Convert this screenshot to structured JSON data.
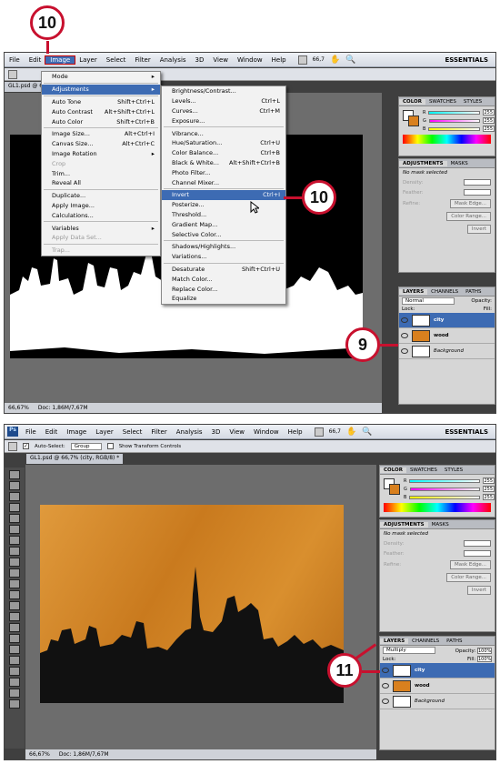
{
  "shot1": {
    "menubar": [
      "File",
      "Edit",
      "Image",
      "Layer",
      "Select",
      "Filter",
      "Analysis",
      "3D",
      "View",
      "Window",
      "Help"
    ],
    "zoom": "66,7",
    "workspace": "ESSENTIALS",
    "doc_tab": "GL1.psd @ 66,7",
    "status_zoom": "66,67%",
    "status_doc": "Doc: 1,86M/7,67M",
    "image_menu": [
      {
        "label": "Mode",
        "shortcut": "",
        "sub": true
      },
      {
        "sep": true
      },
      {
        "label": "Adjustments",
        "shortcut": "",
        "sub": true,
        "hl": true
      },
      {
        "sep": true
      },
      {
        "label": "Auto Tone",
        "shortcut": "Shift+Ctrl+L"
      },
      {
        "label": "Auto Contrast",
        "shortcut": "Alt+Shift+Ctrl+L"
      },
      {
        "label": "Auto Color",
        "shortcut": "Shift+Ctrl+B"
      },
      {
        "sep": true
      },
      {
        "label": "Image Size...",
        "shortcut": "Alt+Ctrl+I"
      },
      {
        "label": "Canvas Size...",
        "shortcut": "Alt+Ctrl+C"
      },
      {
        "label": "Image Rotation",
        "shortcut": "",
        "sub": true
      },
      {
        "label": "Crop",
        "shortcut": "",
        "dis": true
      },
      {
        "label": "Trim...",
        "shortcut": ""
      },
      {
        "label": "Reveal All",
        "shortcut": ""
      },
      {
        "sep": true
      },
      {
        "label": "Duplicate...",
        "shortcut": ""
      },
      {
        "label": "Apply Image...",
        "shortcut": ""
      },
      {
        "label": "Calculations...",
        "shortcut": ""
      },
      {
        "sep": true
      },
      {
        "label": "Variables",
        "shortcut": "",
        "sub": true
      },
      {
        "label": "Apply Data Set...",
        "shortcut": "",
        "dis": true
      },
      {
        "sep": true
      },
      {
        "label": "Trap...",
        "shortcut": "",
        "dis": true
      }
    ],
    "adj_menu": [
      {
        "label": "Brightness/Contrast...",
        "shortcut": ""
      },
      {
        "label": "Levels...",
        "shortcut": "Ctrl+L"
      },
      {
        "label": "Curves...",
        "shortcut": "Ctrl+M"
      },
      {
        "label": "Exposure...",
        "shortcut": ""
      },
      {
        "sep": true
      },
      {
        "label": "Vibrance...",
        "shortcut": ""
      },
      {
        "label": "Hue/Saturation...",
        "shortcut": "Ctrl+U"
      },
      {
        "label": "Color Balance...",
        "shortcut": "Ctrl+B"
      },
      {
        "label": "Black & White...",
        "shortcut": "Alt+Shift+Ctrl+B"
      },
      {
        "label": "Photo Filter...",
        "shortcut": ""
      },
      {
        "label": "Channel Mixer...",
        "shortcut": ""
      },
      {
        "sep": true
      },
      {
        "label": "Invert",
        "shortcut": "Ctrl+I",
        "hl": true
      },
      {
        "label": "Posterize...",
        "shortcut": ""
      },
      {
        "label": "Threshold...",
        "shortcut": ""
      },
      {
        "label": "Gradient Map...",
        "shortcut": ""
      },
      {
        "label": "Selective Color...",
        "shortcut": ""
      },
      {
        "sep": true
      },
      {
        "label": "Shadows/Highlights...",
        "shortcut": ""
      },
      {
        "label": "Variations...",
        "shortcut": ""
      },
      {
        "sep": true
      },
      {
        "label": "Desaturate",
        "shortcut": "Shift+Ctrl+U"
      },
      {
        "label": "Match Color...",
        "shortcut": ""
      },
      {
        "label": "Replace Color...",
        "shortcut": ""
      },
      {
        "label": "Equalize",
        "shortcut": ""
      }
    ],
    "color_tabs": [
      "COLOR",
      "SWATCHES",
      "STYLES"
    ],
    "rgb": [
      {
        "ch": "R",
        "val": "255"
      },
      {
        "ch": "G",
        "val": "255"
      },
      {
        "ch": "B",
        "val": "255"
      }
    ],
    "adj_tabs": [
      "ADJUSTMENTS",
      "MASKS"
    ],
    "mask_label": "No mask selected",
    "mask_fields": [
      "Density:",
      "Feather:"
    ],
    "refine": "Refine:",
    "mask_buttons": [
      "Mask Edge...",
      "Color Range...",
      "Invert"
    ],
    "layer_tabs": [
      "LAYERS",
      "CHANNELS",
      "PATHS"
    ],
    "blend_mode": "Normal",
    "opacity_label": "Opacity:",
    "lock_label": "Lock:",
    "fill_label": "Fill:",
    "layers": [
      {
        "name": "city",
        "selected": true,
        "thumb": "#ffffff"
      },
      {
        "name": "wood",
        "selected": false,
        "thumb": "#d9801e"
      },
      {
        "name": "Background",
        "selected": false,
        "thumb": "#ffffff"
      }
    ],
    "callouts": [
      "10",
      "10",
      "9"
    ]
  },
  "shot2": {
    "menubar": [
      "File",
      "Edit",
      "Image",
      "Layer",
      "Select",
      "Filter",
      "Analysis",
      "3D",
      "View",
      "Window",
      "Help"
    ],
    "zoom": "66,7",
    "workspace": "ESSENTIALS",
    "auto_select": "Auto-Select:",
    "group": "Group",
    "show_transform": "Show Transform Controls",
    "doc_tab": "GL1.psd @ 66,7% (city, RGB/8) *",
    "status_zoom": "66,67%",
    "status_doc": "Doc: 1,86M/7,67M",
    "color_tabs": [
      "COLOR",
      "SWATCHES",
      "STYLES"
    ],
    "rgb": [
      {
        "ch": "R",
        "val": "255"
      },
      {
        "ch": "G",
        "val": "255"
      },
      {
        "ch": "B",
        "val": "255"
      }
    ],
    "adj_tabs": [
      "ADJUSTMENTS",
      "MASKS"
    ],
    "mask_label": "No mask selected",
    "mask_fields": [
      "Density:",
      "Feather:"
    ],
    "refine": "Refine:",
    "mask_buttons": [
      "Mask Edge...",
      "Color Range...",
      "Invert"
    ],
    "layer_tabs": [
      "LAYERS",
      "CHANNELS",
      "PATHS"
    ],
    "blend_mode": "Multiply",
    "opacity_label": "Opacity:",
    "opacity_val": "100%",
    "lock_label": "Lock:",
    "fill_label": "Fill:",
    "fill_val": "100%",
    "layers": [
      {
        "name": "city",
        "selected": true,
        "thumb": "#ffffff"
      },
      {
        "name": "wood",
        "selected": false,
        "thumb": "#d9801e"
      },
      {
        "name": "Background",
        "selected": false,
        "thumb": "#ffffff"
      }
    ],
    "callouts": [
      "11"
    ]
  },
  "colors": {
    "accent": "#3d6bb3",
    "callout": "#c8102e",
    "wood": "#d08524"
  }
}
